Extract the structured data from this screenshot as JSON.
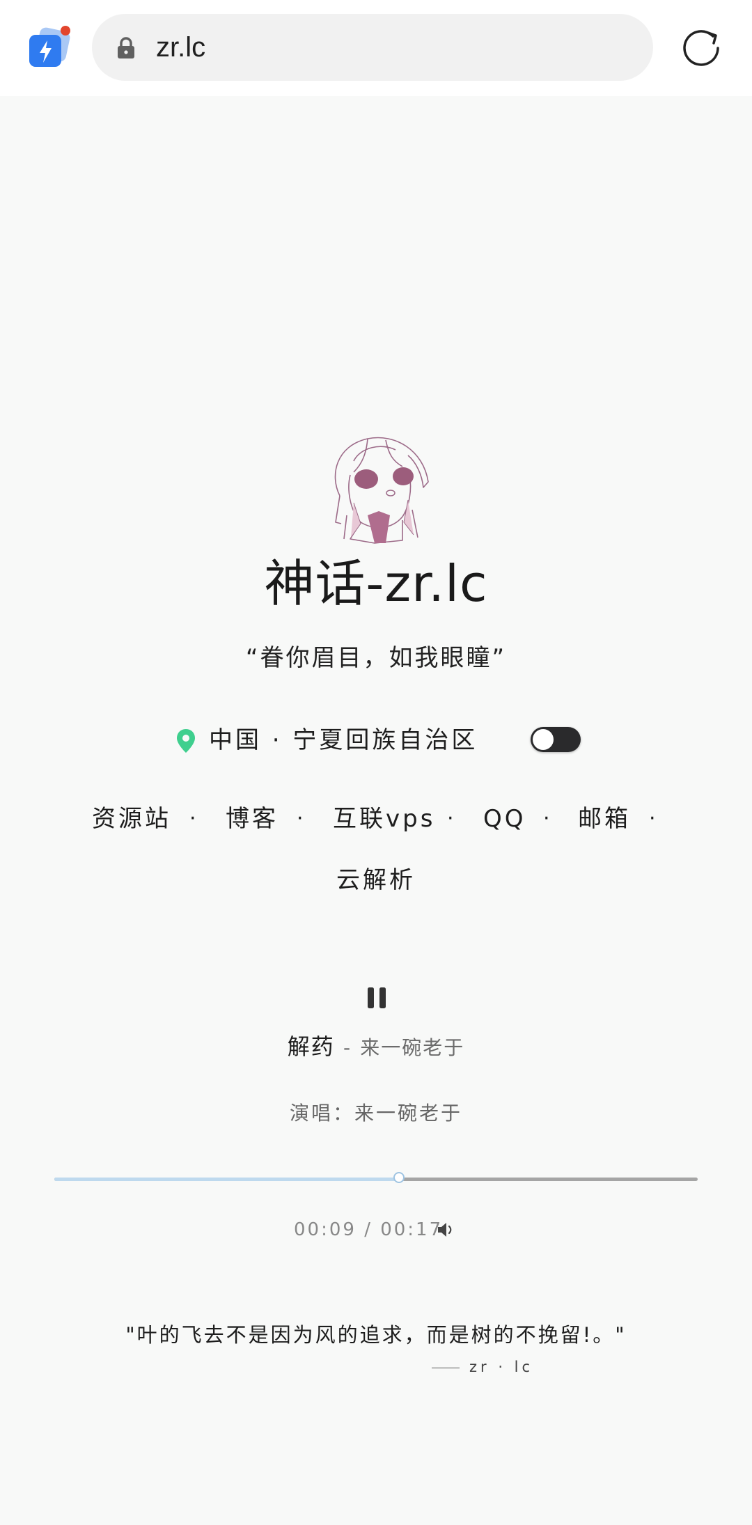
{
  "browser": {
    "url": "zr.lc"
  },
  "site": {
    "title": "神话-zr.lc",
    "motto": "“眷你眉目，如我眼瞳”",
    "location": "中国 · 宁夏回族自治区",
    "theme_toggle": "off"
  },
  "nav": {
    "links": [
      "资源站",
      "博客",
      "互联vps",
      "QQ",
      "邮箱",
      "云解析"
    ],
    "separator": "·"
  },
  "player": {
    "song_title": "解药",
    "song_separator": "-",
    "song_artist": "来一碗老于",
    "singer_line": "演唱：来一碗老于",
    "time": "00:09 / 00:17",
    "progress_fraction": 0.536
  },
  "quote": {
    "text": "\"叶的飞去不是因为风的追求，而是树的不挽留!。\"",
    "author": "zr · lc"
  },
  "colors": {
    "accent_green": "#3fcf8e",
    "progress_played": "#bed9ee",
    "progress_rest": "#a5a5a5",
    "avatar_line": "#9c6a88"
  }
}
